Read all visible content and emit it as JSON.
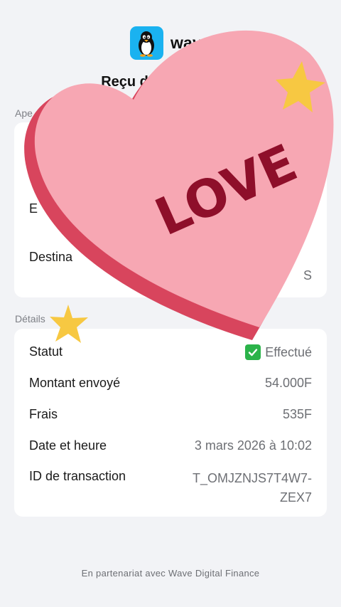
{
  "header": {
    "brand": "wave",
    "title": "Reçu de Transaction"
  },
  "expediteur_section": {
    "label": "Ape",
    "rows": [
      {
        "key": "E",
        "value": ""
      },
      {
        "key": "Destina",
        "value": "S"
      }
    ]
  },
  "details": {
    "label": "Détails",
    "statut_key": "Statut",
    "statut_value": "Effectué",
    "montant_key": "Montant envoyé",
    "montant_value": "54.000F",
    "frais_key": "Frais",
    "frais_value": "535F",
    "date_key": "Date et heure",
    "date_value": "3 mars 2026 à 10:02",
    "id_key": "ID de transaction",
    "id_value_line1": "T_OMJZNJS7T4W7-",
    "id_value_line2": "ZEX7"
  },
  "sticker": {
    "text": "LOVE",
    "heart_color": "#f7a7b3",
    "heart_side_color": "#d8455d",
    "text_color": "#8e0f2a",
    "star_color": "#f7c842"
  },
  "footer": "En partenariat avec Wave Digital Finance"
}
